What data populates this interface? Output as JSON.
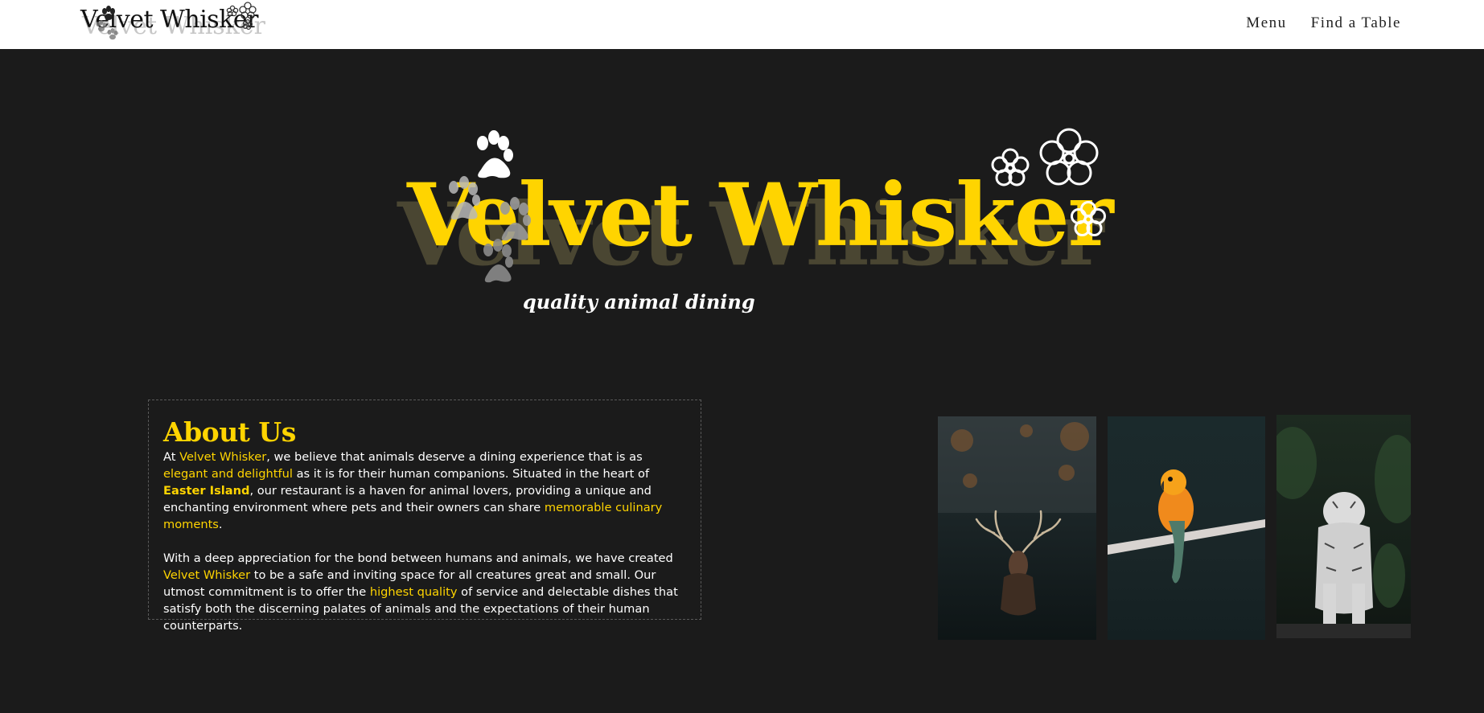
{
  "nav": {
    "logo_text": "Velvet Whisker",
    "links": [
      "Menu",
      "Find a Table"
    ]
  },
  "hero": {
    "title": "Velvet Whisker",
    "tagline": "quality animal dining",
    "decor_icons": [
      "paw-icon",
      "flower-icon"
    ]
  },
  "about": {
    "title": "About Us",
    "p1": {
      "a": "At ",
      "b": "Velvet Whisker",
      "c": ", we believe that animals deserve a dining experience that is as ",
      "d": "elegant and delightful",
      "e": " as it is for their human companions. Situated in the heart of ",
      "f": "Easter Island",
      "g": ", our restaurant is a haven for animal lovers, providing a unique and enchanting environment where pets and their owners can share ",
      "h": "memorable culinary moments",
      "i": "."
    },
    "p2": {
      "a": "With a deep appreciation for the bond between humans and animals, we have created ",
      "b": "Velvet Whisker",
      "c": " to be a safe and inviting space for all creatures great and small. Our utmost commitment is to offer the ",
      "d": "highest quality",
      "e": " of service and delectable dishes that satisfy both the discerning palates of animals and the expectations of their human counterparts."
    }
  },
  "photos": [
    "deer-photo",
    "parrot-photo",
    "tiger-photo"
  ],
  "colors": {
    "accent": "#ffd400",
    "background": "#1b1b1b",
    "navbar": "#ffffff"
  }
}
